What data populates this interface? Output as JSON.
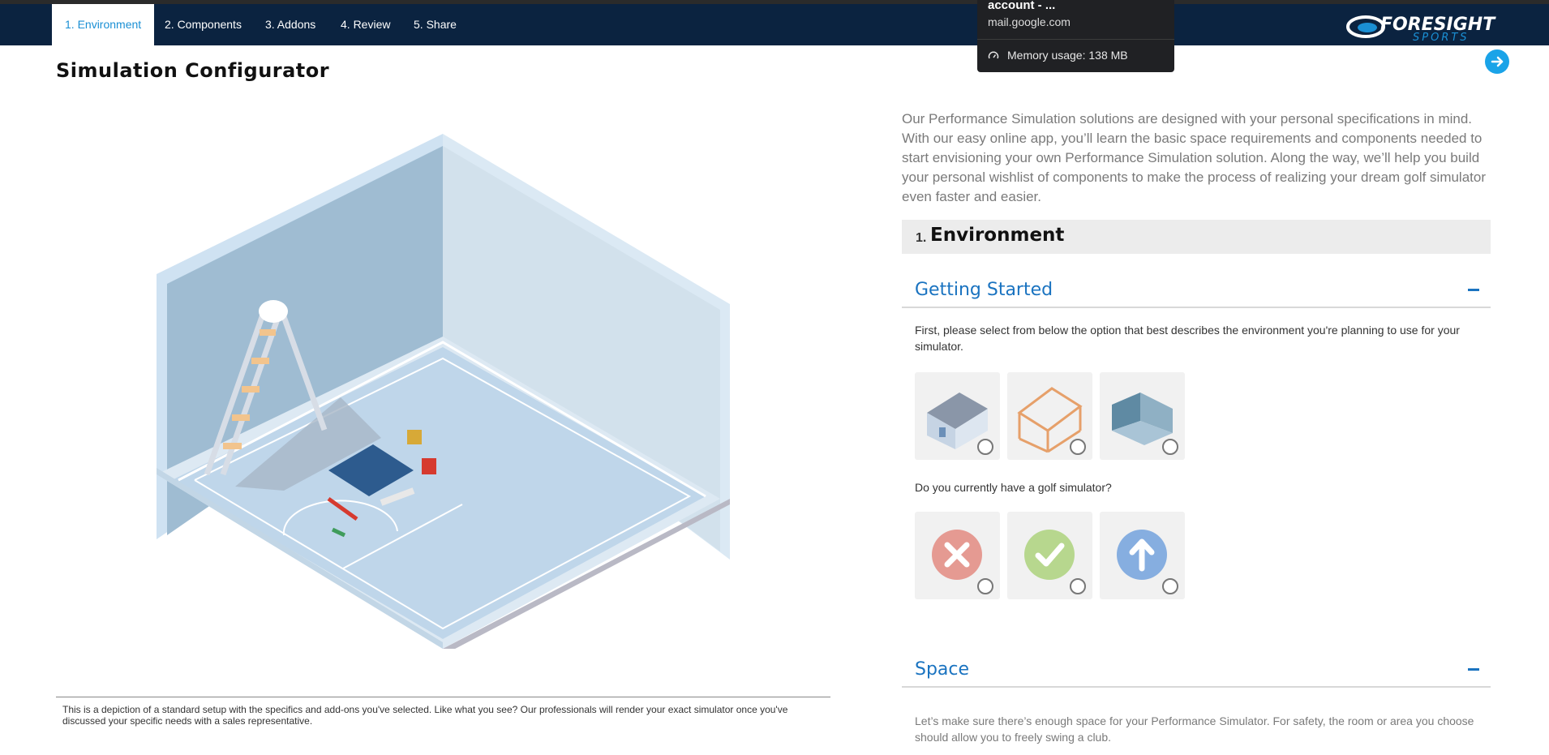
{
  "nav": {
    "tabs": [
      {
        "label": "1. Environment"
      },
      {
        "label": "2. Components"
      },
      {
        "label": "3. Addons"
      },
      {
        "label": "4. Review"
      },
      {
        "label": "5. Share"
      }
    ],
    "logo_text": "FORESIGHT",
    "logo_subtext": "SPORTS"
  },
  "page": {
    "title": "Simulation Configurator",
    "caption": "This is a depiction of a standard setup with the specifics and add-ons you've selected. Like what you see? Our professionals will render your exact simulator once you've discussed your specific needs with a sales representative."
  },
  "panel": {
    "intro": "Our Performance Simulation solutions are designed with your personal specifications in mind. With our easy online app, you’ll learn the basic space requirements and components needed to start envisioning your own Performance Simulation solution. Along the way, we’ll help you build your personal wishlist of components to make the process of realizing your dream golf simulator even faster and easier.",
    "step_number": "1.",
    "step_title": "Environment",
    "getting_started": {
      "title": "Getting Started",
      "q1": "First, please select from below the option that best describes the environment you're planning to use for your simulator.",
      "q2": "Do you currently have a golf simulator?"
    },
    "space": {
      "title": "Space",
      "text": "Let’s make sure there’s enough space for your Performance Simulator. For safety, the room or area you choose should allow you to freely swing a club."
    }
  },
  "tooltip": {
    "title": "account - ...",
    "url": "mail.google.com",
    "memory": "Memory usage: 138 MB"
  },
  "colors": {
    "nav_bg": "#0b2340",
    "accent": "#1a8fd4",
    "heading_blue": "#1a73c0"
  }
}
